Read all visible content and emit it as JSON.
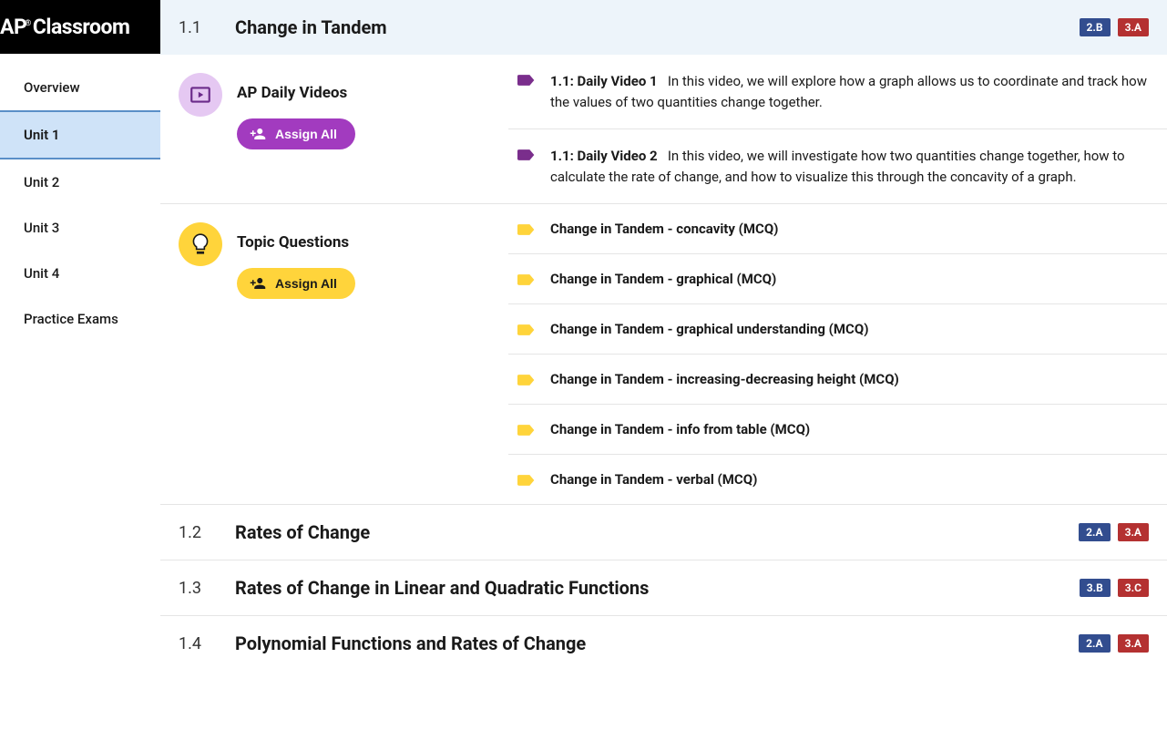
{
  "logo": {
    "prefix": "AP",
    "suffix": "Classroom"
  },
  "nav": [
    {
      "label": "Overview",
      "active": false
    },
    {
      "label": "Unit 1",
      "active": true
    },
    {
      "label": "Unit 2",
      "active": false
    },
    {
      "label": "Unit 3",
      "active": false
    },
    {
      "label": "Unit 4",
      "active": false
    },
    {
      "label": "Practice Exams",
      "active": false
    }
  ],
  "topics": [
    {
      "num": "1.1",
      "title": "Change in Tandem",
      "tags": [
        {
          "label": "2.B",
          "color": "blue"
        },
        {
          "label": "3.A",
          "color": "red"
        }
      ],
      "expanded": true
    },
    {
      "num": "1.2",
      "title": "Rates of Change",
      "tags": [
        {
          "label": "2.A",
          "color": "blue"
        },
        {
          "label": "3.A",
          "color": "red"
        }
      ]
    },
    {
      "num": "1.3",
      "title": "Rates of Change in Linear and Quadratic Functions",
      "tags": [
        {
          "label": "3.B",
          "color": "blue"
        },
        {
          "label": "3.C",
          "color": "red"
        }
      ]
    },
    {
      "num": "1.4",
      "title": "Polynomial Functions and Rates of Change",
      "tags": [
        {
          "label": "2.A",
          "color": "blue"
        },
        {
          "label": "3.A",
          "color": "red"
        }
      ]
    }
  ],
  "videos_section": {
    "title": "AP Daily Videos",
    "assign_label": "Assign All",
    "items": [
      {
        "bold": "1.1: Daily Video 1",
        "desc": "In this video, we will explore how a graph allows us to coordinate and track how the values of two quantities change together."
      },
      {
        "bold": "1.1: Daily Video 2",
        "desc": "In this video, we will investigate how two quantities change together, how to calculate the rate of change, and how to visualize this through the concavity of a graph."
      }
    ]
  },
  "questions_section": {
    "title": "Topic Questions",
    "assign_label": "Assign All",
    "items": [
      {
        "title": "Change in Tandem - concavity (MCQ)"
      },
      {
        "title": "Change in Tandem - graphical (MCQ)"
      },
      {
        "title": "Change in Tandem - graphical understanding (MCQ)"
      },
      {
        "title": "Change in Tandem - increasing-decreasing height (MCQ)"
      },
      {
        "title": "Change in Tandem - info from table (MCQ)"
      },
      {
        "title": "Change in Tandem - verbal (MCQ)"
      }
    ]
  }
}
